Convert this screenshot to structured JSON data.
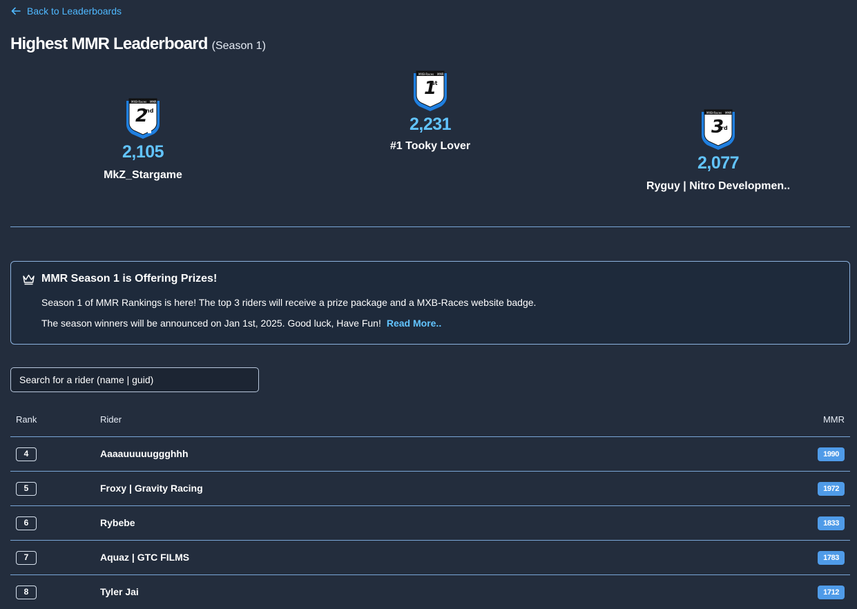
{
  "nav": {
    "back_label": "Back to Leaderboards"
  },
  "header": {
    "title": "Highest MMR Leaderboard",
    "subtitle": "(Season 1)"
  },
  "podium": {
    "first": {
      "place_number": "1",
      "place_suffix": "st",
      "badge_top_left": "MXB-Races",
      "badge_top_right": "MMR",
      "score": "2,231",
      "name": "#1 Tooky Lover"
    },
    "second": {
      "place_number": "2",
      "place_suffix": "nd",
      "badge_top_left": "MXB-Races",
      "badge_top_right": "MMR",
      "score": "2,105",
      "name": "MkZ_Stargame"
    },
    "third": {
      "place_number": "3",
      "place_suffix": "rd",
      "badge_top_left": "MXB-Races",
      "badge_top_right": "MMR",
      "score": "2,077",
      "name": "Ryguy | Nitro Developmen.."
    }
  },
  "prize": {
    "title": "MMR Season 1 is Offering Prizes!",
    "line1": "Season 1 of MMR Rankings is here! The top 3 riders will receive a prize package and a MXB-Races website badge.",
    "line2": "The season winners will be announced on Jan 1st, 2025. Good luck, Have Fun!",
    "read_more": "Read More.."
  },
  "search": {
    "placeholder": "Search for a rider (name | guid)"
  },
  "table": {
    "headers": {
      "rank": "Rank",
      "rider": "Rider",
      "mmr": "MMR"
    },
    "rows": [
      {
        "rank": "4",
        "rider": "Aaaauuuuuggghhh",
        "mmr": "1990"
      },
      {
        "rank": "5",
        "rider": "Froxy | Gravity Racing",
        "mmr": "1972"
      },
      {
        "rank": "6",
        "rider": "Rybebe",
        "mmr": "1833"
      },
      {
        "rank": "7",
        "rider": "Aquaz | GTC FILMS",
        "mmr": "1783"
      },
      {
        "rank": "8",
        "rider": "Tyler Jai",
        "mmr": "1712"
      }
    ]
  },
  "colors": {
    "background": "#232d3d",
    "accent": "#4fb8ff",
    "score": "#62c4ff",
    "pill": "#4f9be8",
    "border": "#7aa7d8"
  },
  "icons": {
    "back": "arrow-left-icon",
    "prize": "crown-icon",
    "badge": "plate-badge-icon"
  }
}
